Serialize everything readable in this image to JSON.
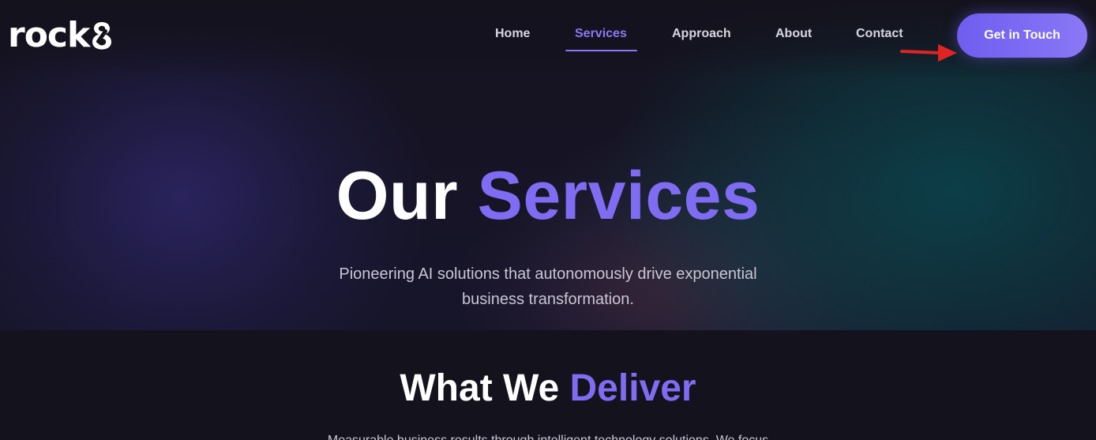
{
  "brand": {
    "logo_text": "rock",
    "logo_mark_icon": "figure-eight-logo-icon"
  },
  "nav": {
    "links": [
      {
        "label": "Home",
        "active": false
      },
      {
        "label": "Services",
        "active": true
      },
      {
        "label": "Approach",
        "active": false
      },
      {
        "label": "About",
        "active": false
      },
      {
        "label": "Contact",
        "active": false
      }
    ],
    "cta_label": "Get in Touch"
  },
  "annotation": {
    "arrow_icon": "red-arrow-right-icon",
    "color": "#e02424"
  },
  "hero": {
    "title_plain": "Our",
    "title_accent": "Services",
    "subtitle": "Pioneering AI solutions that autonomously drive exponential business transformation."
  },
  "section": {
    "title_plain": "What We",
    "title_accent": "Deliver",
    "text": "Measurable business results through intelligent technology solutions. We focus"
  },
  "colors": {
    "accent": "#7f6cf2",
    "background": "#14121d",
    "text": "#ffffff"
  }
}
